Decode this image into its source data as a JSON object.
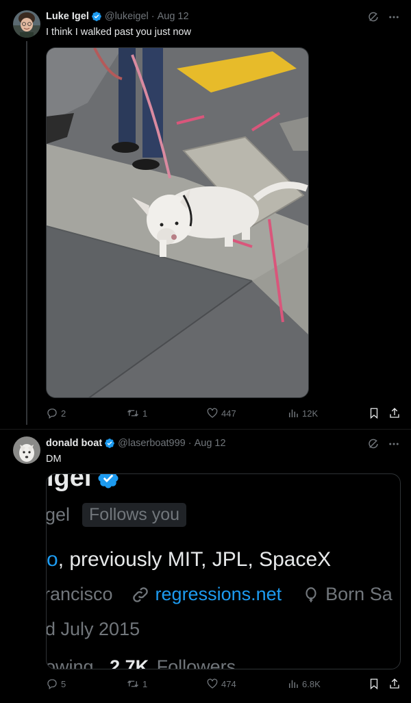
{
  "tweets": [
    {
      "author_name": "Luke Igel",
      "author_handle": "@lukeigel",
      "date": "Aug 12",
      "text": "I think I walked past you just now",
      "replies": "2",
      "retweets": "1",
      "likes": "447",
      "views": "12K"
    },
    {
      "author_name": "donald boat",
      "author_handle": "@laserboat999",
      "date": "Aug 12",
      "text": "DM",
      "replies": "5",
      "retweets": "1",
      "likes": "474",
      "views": "6.8K",
      "embedded_profile": {
        "name_fragment": "lgel",
        "handle_fragment": "gel",
        "follows_badge": "Follows you",
        "bio_link_fragment": "o",
        "bio_rest": ", previously MIT, JPL, SpaceX",
        "location_fragment": "rancisco",
        "website": "regressions.net",
        "born_fragment": "Born Sa",
        "joined_fragment": "d July 2015",
        "following_fragment": "owing",
        "followers_count": "2.7K",
        "followers_label": "Followers"
      }
    }
  ],
  "colors": {
    "background": "#000000",
    "text": "#e7e9ea",
    "muted": "#71767b",
    "verified": "#1d9bf0",
    "link": "#1d9bf0",
    "border": "#2f3336"
  },
  "icons": [
    "verified-badge-icon",
    "grok-icon",
    "more-icon",
    "reply-icon",
    "retweet-icon",
    "like-icon",
    "views-icon",
    "bookmark-icon",
    "share-icon"
  ]
}
